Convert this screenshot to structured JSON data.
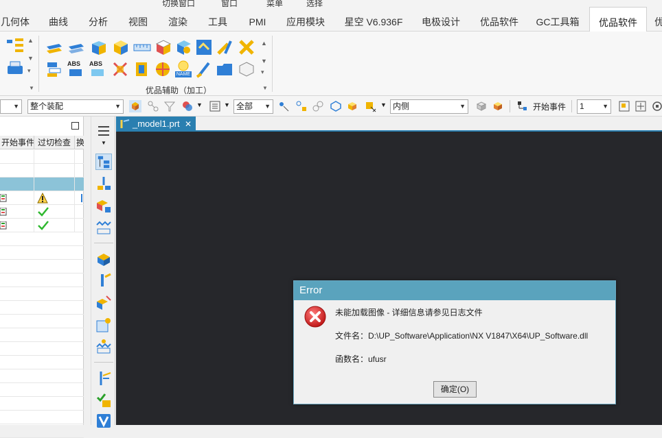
{
  "quickbar": {
    "switch_window_label": "切换窗口",
    "window_label": "窗口",
    "menu_label": "菜单",
    "select_label": "选择"
  },
  "tabs": [
    {
      "label": "几何体"
    },
    {
      "label": "曲线"
    },
    {
      "label": "分析"
    },
    {
      "label": "视图"
    },
    {
      "label": "渲染"
    },
    {
      "label": "工具"
    },
    {
      "label": "PMI"
    },
    {
      "label": "应用模块"
    },
    {
      "label": "星空 V6.936F"
    },
    {
      "label": "电极设计"
    },
    {
      "label": "优品软件"
    },
    {
      "label": "GC工具箱"
    },
    {
      "label": "优品软件"
    },
    {
      "label": "优"
    }
  ],
  "active_tab_index": 12,
  "ribbon": {
    "group_label": "优品辅助（加工）",
    "icon_labels": {
      "abs1": "ABS",
      "abs2": "ABS",
      "name": "NAME"
    }
  },
  "selection_toolbar": {
    "filter_left": "",
    "scope": "整个装配",
    "type_filter": "全部",
    "side": "内侧",
    "start_event_label": "开始事件",
    "count": "1"
  },
  "navigator": {
    "columns": [
      "开始事件",
      "过切检查",
      "换"
    ],
    "rows": [
      {
        "check": "",
        "status": ""
      },
      {
        "check": "",
        "status": ""
      },
      {
        "check": "",
        "status": "",
        "selected": true
      },
      {
        "check": "warning",
        "status": "warning"
      },
      {
        "check": "ok",
        "status": "ok"
      },
      {
        "check": "ok",
        "status": "ok"
      }
    ]
  },
  "document": {
    "tab_label": "_model1.prt",
    "close_glyph": "✕"
  },
  "dialog": {
    "title": "Error",
    "line1": "未能加载图像 - 详细信息请参见日志文件",
    "line2": "文件名：D:\\UP_Software\\Application\\NX V1847\\X64\\UP_Software.dll",
    "line3": "函数名：ufusr",
    "ok_label": "确定(O)"
  },
  "colors": {
    "accent": "#2a7fb0",
    "dialog_title": "#5aa3bd",
    "graphics_bg": "#26272b",
    "selected_row": "#8cc3d8",
    "error_red": "#d42a2a"
  }
}
